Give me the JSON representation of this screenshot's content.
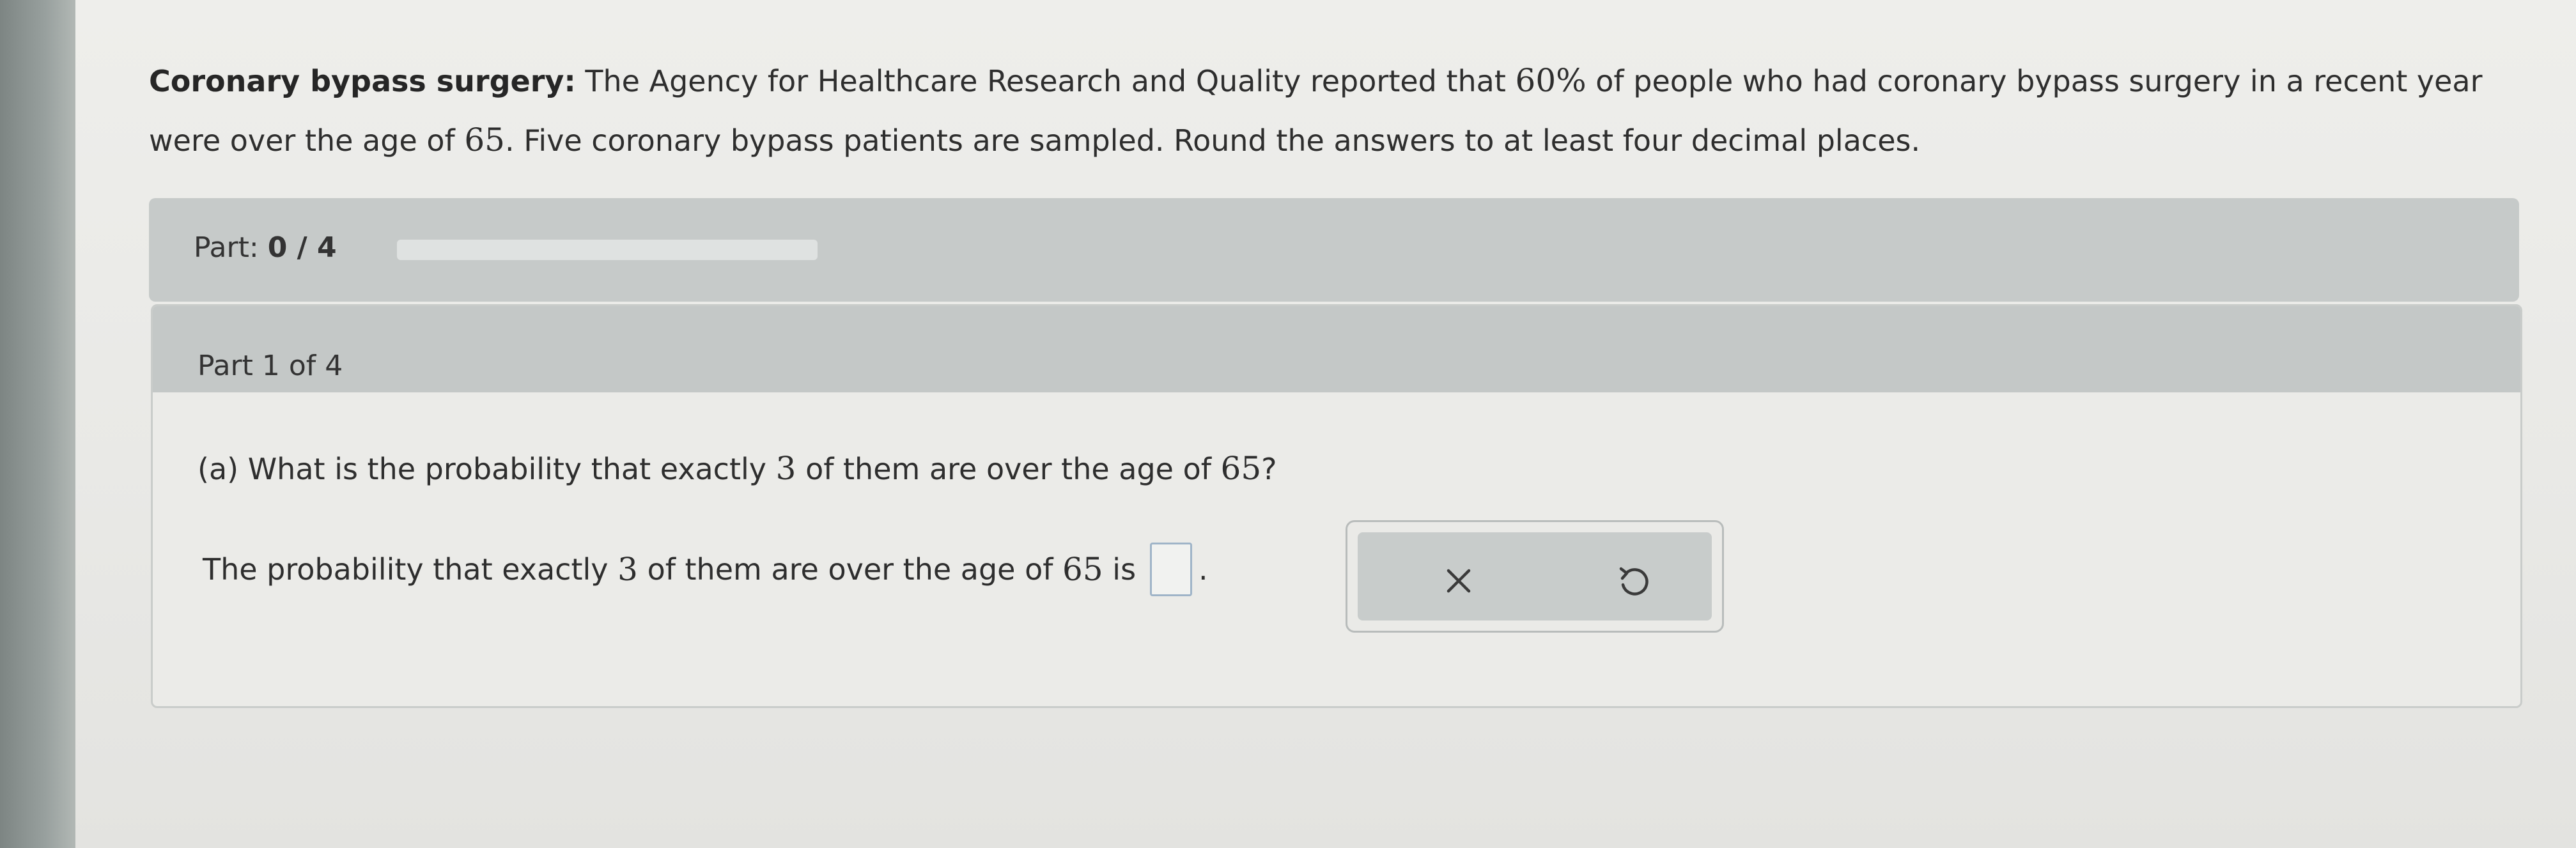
{
  "problem": {
    "lead": "Coronary bypass surgery:",
    "line1_a": "The Agency for Healthcare Research and Quality reported that",
    "percent": "60%",
    "line1_b": "of people who had coronary bypass surgery in a recent year",
    "line2_a": "were over the age of",
    "age": "65",
    "line2_b": ". Five coronary bypass patients are sampled. Round the answers to at least four decimal places."
  },
  "progress": {
    "prefix": "Part:",
    "value": "0 / 4",
    "fraction": 0,
    "fill_color": "#5d8fbf"
  },
  "part": {
    "header": "Part 1 of 4",
    "question_a": "(a) What is the probability that exactly",
    "question_k": "3",
    "question_b": "of them are over the age of",
    "question_age": "65",
    "question_end": "?",
    "answer_a": "The probability that exactly",
    "answer_k": "3",
    "answer_b": "of them are over the age of",
    "answer_age": "65",
    "answer_c": "is",
    "answer_value": "",
    "period": "."
  },
  "actions": {
    "clear_icon": "x-icon",
    "undo_icon": "undo-icon"
  }
}
